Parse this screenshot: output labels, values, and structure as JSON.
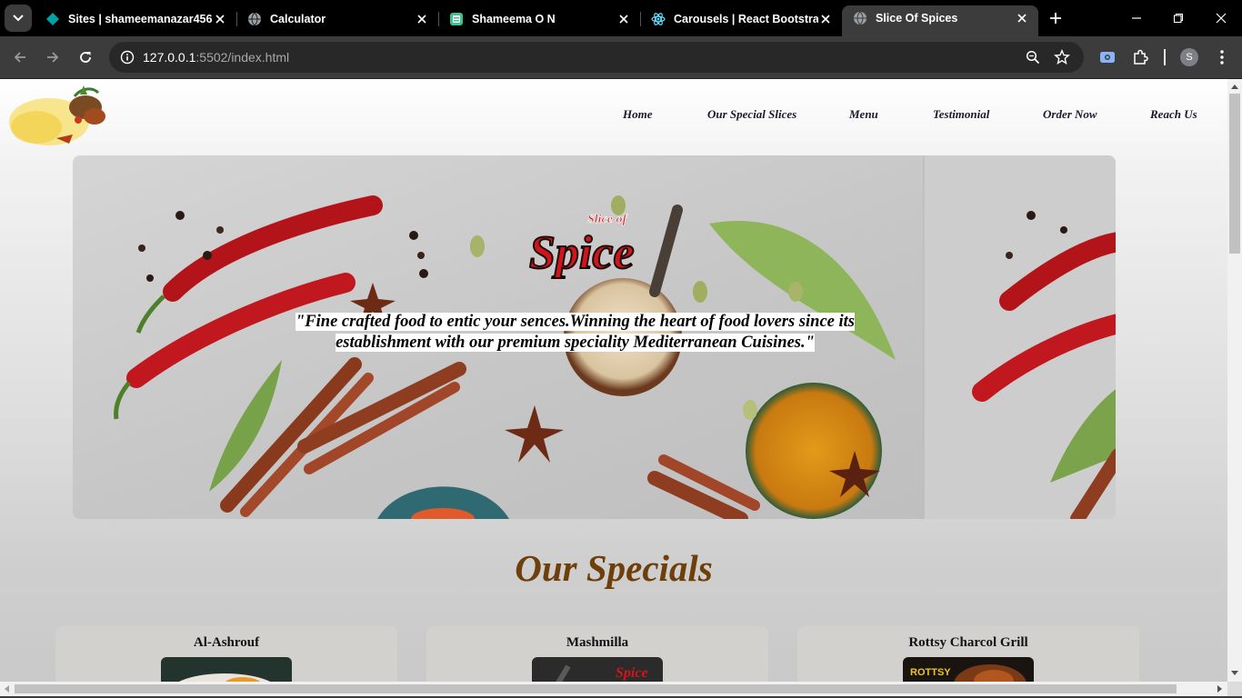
{
  "browser": {
    "tabs": [
      {
        "title": "Sites | shameemanazar456 |",
        "icon": "google-sites-icon"
      },
      {
        "title": "Calculator",
        "icon": "globe-icon"
      },
      {
        "title": "Shameema O N",
        "icon": "document-icon"
      },
      {
        "title": "Carousels | React Bootstrap",
        "icon": "react-icon"
      },
      {
        "title": "Slice Of Spices",
        "icon": "globe-icon",
        "active": true
      }
    ],
    "url_host": "127.0.0.1",
    "url_rest": ":5502/index.html",
    "profile_initial": "S"
  },
  "site": {
    "logo_text": "Slice of Spice",
    "nav": [
      "Home",
      "Our Special Slices",
      "Menu",
      "Testimonial",
      "Order Now",
      "Reach Us"
    ],
    "hero": {
      "logo_small": "Slice of",
      "logo_big": "Spice",
      "quote": "\"Fine crafted food to entic your sences.Winning the heart of food lovers since its establishment with our premium speciality Mediterranean Cuisines.\""
    },
    "specials_title": "Our Specials",
    "cards": [
      {
        "title": "Al-Ashrouf"
      },
      {
        "title": "Mashmilla"
      },
      {
        "title": "Rottsy Charcol Grill"
      }
    ]
  },
  "colors": {
    "accent_brown": "#6e3f0a",
    "spice_red": "#d0161c",
    "tabbar": "#000000",
    "toolbar": "#3c3c3c"
  }
}
